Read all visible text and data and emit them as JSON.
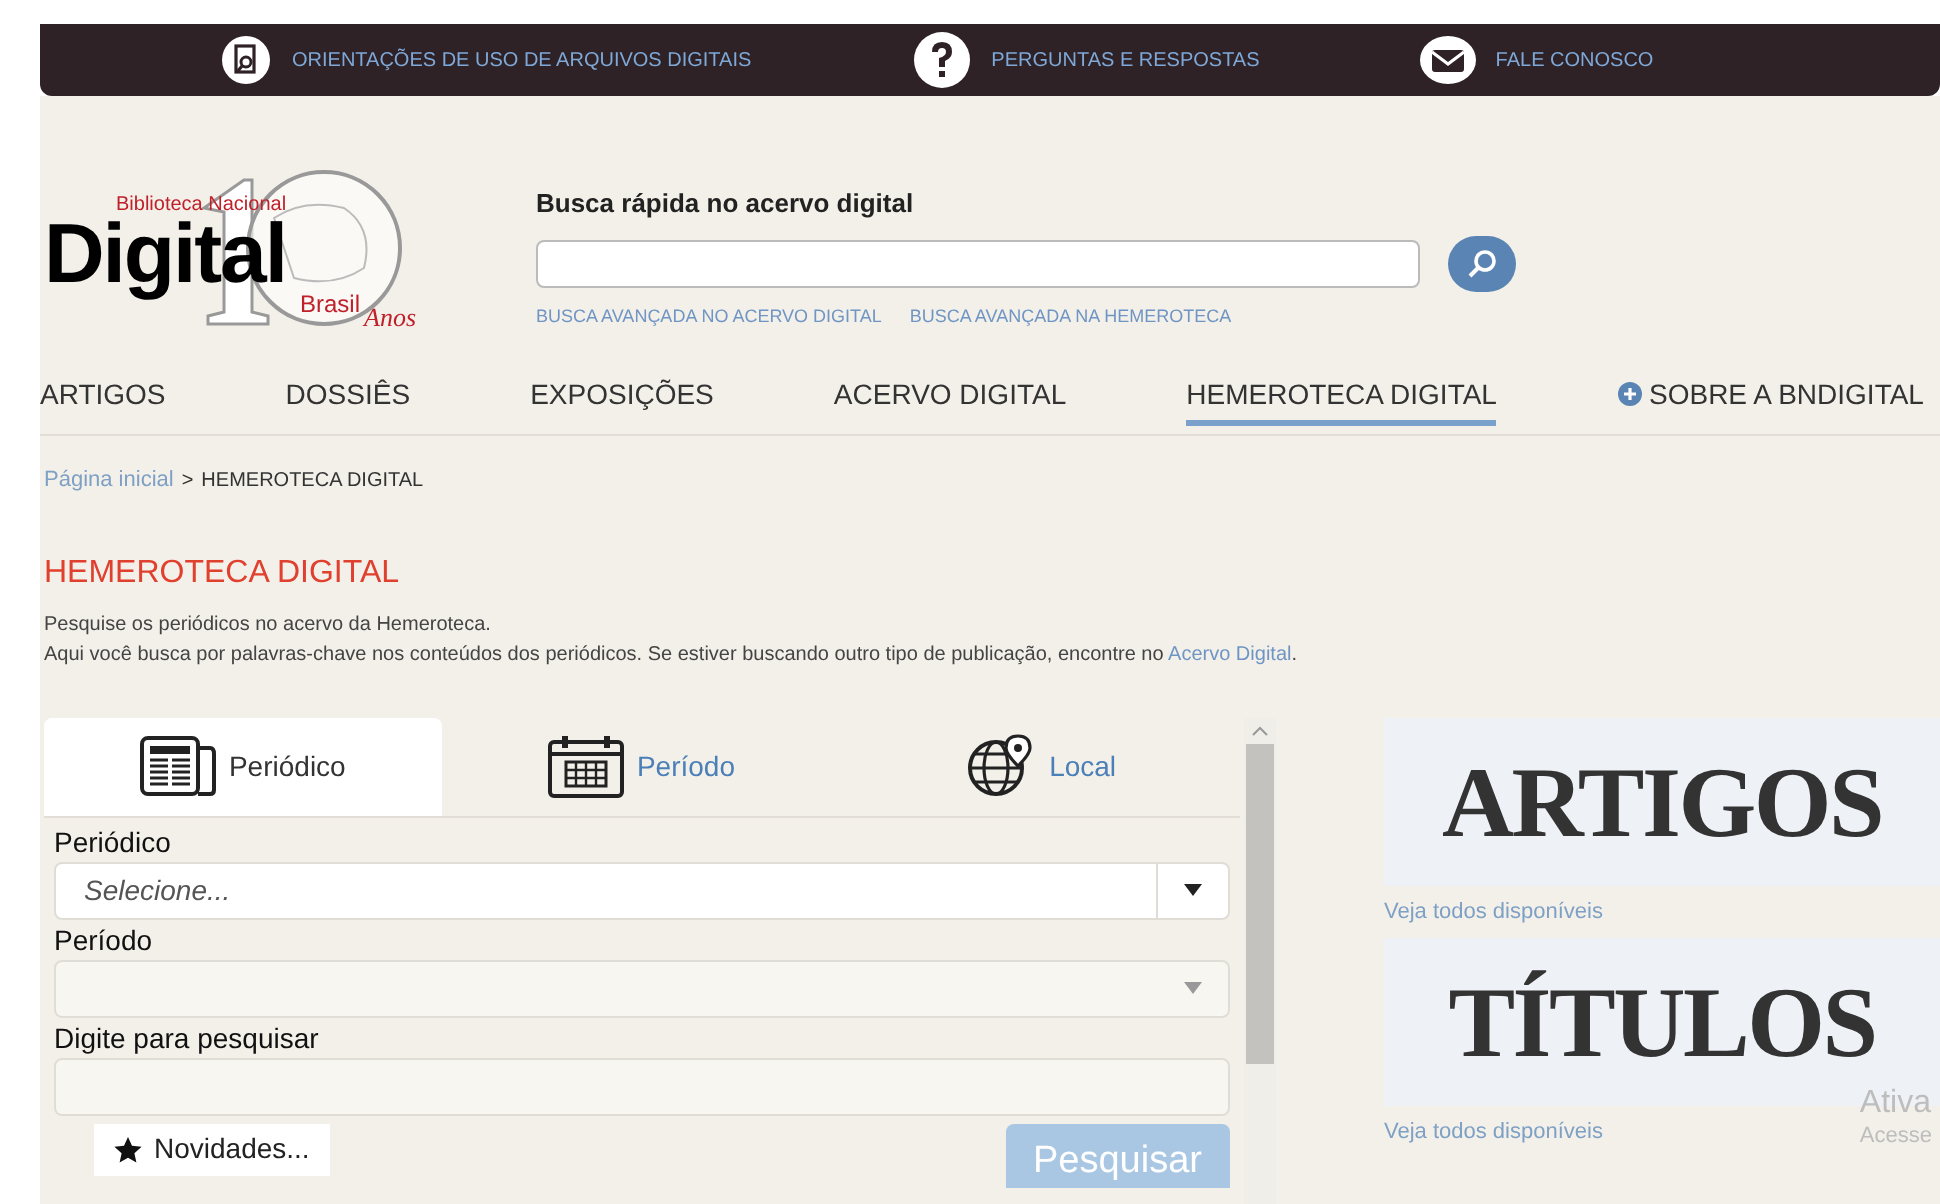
{
  "top_bar": {
    "links": [
      {
        "label": "ORIENTAÇÕES DE USO DE ARQUIVOS DIGITAIS",
        "kind": "doc"
      },
      {
        "label": "PERGUNTAS E RESPOSTAS",
        "kind": "question"
      },
      {
        "label": "FALE CONOSCO",
        "kind": "mail"
      }
    ]
  },
  "logo": {
    "line_1": "Biblioteca Nacional",
    "line_2": "Digital",
    "line_3": "Brasil",
    "line_4": "Anos"
  },
  "quick_search": {
    "label": "Busca rápida no acervo digital",
    "links": [
      "BUSCA AVANÇADA NO ACERVO DIGITAL",
      "BUSCA AVANÇADA NA HEMEROTECA"
    ]
  },
  "nav": [
    {
      "label": "ARTIGOS",
      "selected": false,
      "kind": "link"
    },
    {
      "label": "DOSSIÊS",
      "selected": false,
      "kind": "link"
    },
    {
      "label": "EXPOSIÇÕES",
      "selected": false,
      "kind": "link"
    },
    {
      "label": "ACERVO DIGITAL",
      "selected": false,
      "kind": "link"
    },
    {
      "label": "HEMEROTECA DIGITAL",
      "selected": true,
      "kind": "link"
    },
    {
      "label": "SOBRE A BNDIGITAL",
      "selected": false,
      "kind": "expand"
    }
  ],
  "breadcrumb": {
    "home": "Página inicial",
    "separator": ">",
    "current": "HEMEROTECA DIGITAL"
  },
  "title": "HEMEROTECA DIGITAL",
  "intro": "Pesquise os periódicos no acervo da Hemeroteca.",
  "intro_2": {
    "text": "Aqui você busca por palavras-chave nos conteúdos dos periódicos. Se estiver buscando outro tipo de publicação, encontre no",
    "link": "Acervo Digital",
    "end": "."
  },
  "search_form": {
    "tabs": [
      {
        "label": "Periódico",
        "selected": true,
        "kind": "newspaper"
      },
      {
        "label": "Período",
        "selected": false,
        "kind": "calendar"
      },
      {
        "label": "Local",
        "selected": false,
        "kind": "globe"
      }
    ],
    "fields": [
      {
        "label": "Periódico",
        "kind": "select",
        "placeholder": "Selecione...",
        "disabled": false
      },
      {
        "label": "Período",
        "kind": "select",
        "disabled": true
      },
      {
        "label": "Digite para pesquisar",
        "kind": "input",
        "disabled": true
      }
    ],
    "news_button": "Novidades...",
    "search_button": "Pesquisar"
  },
  "side_cards": [
    {
      "heading": "ARTIGOS",
      "link": "Veja todos disponíveis"
    },
    {
      "heading": "TÍTULOS",
      "link": "Veja todos disponíveis"
    }
  ],
  "system_notice": [
    "Ativa",
    "Acesse"
  ]
}
